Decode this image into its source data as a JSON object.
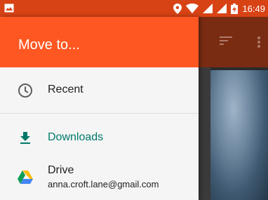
{
  "status_bar": {
    "time": "16:49",
    "colors": {
      "background": "#d84315"
    },
    "icons": [
      "image-notification-icon",
      "location-icon",
      "wifi-icon",
      "signal-icon",
      "battery-charging-icon"
    ]
  },
  "drawer": {
    "title": "Move to...",
    "colors": {
      "header": "#ff5722",
      "accent": "#00796b"
    },
    "items": [
      {
        "label": "Recent",
        "icon": "clock-icon",
        "selected": false
      },
      {
        "label": "Downloads",
        "icon": "download-icon",
        "selected": true
      },
      {
        "label": "Drive",
        "sublabel": "anna.croft.lane@gmail.com",
        "icon": "google-drive-icon",
        "selected": false
      }
    ]
  },
  "background_toolbar": {
    "icons": [
      "sort-icon",
      "more-vert-icon"
    ]
  }
}
